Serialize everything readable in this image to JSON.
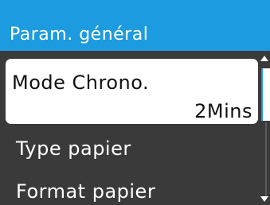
{
  "header": {
    "title": "Param. général"
  },
  "menu": {
    "items": [
      {
        "label": "Mode Chrono.",
        "value": "2Mins",
        "selected": true
      },
      {
        "label": "Type papier"
      },
      {
        "label": "Format papier"
      }
    ]
  },
  "colors": {
    "header_bg": "#1d9be0",
    "menu_bg": "#3a3a3a",
    "selected_bg": "#ffffff"
  },
  "icons": {
    "scroll_up": "scroll-up-icon",
    "scroll_down": "scroll-down-icon"
  }
}
